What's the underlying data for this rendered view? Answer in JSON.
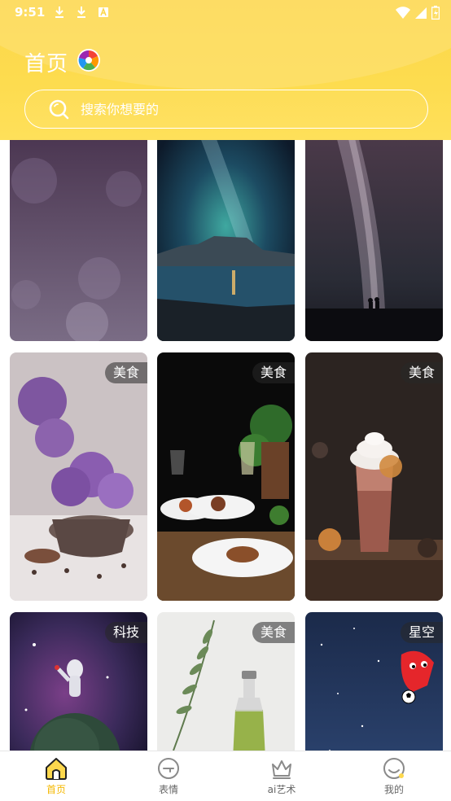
{
  "status_bar": {
    "time": "9:51",
    "icons": [
      "download-icon",
      "download-icon",
      "font-a-icon",
      "wifi-icon",
      "signal-icon",
      "battery-icon"
    ]
  },
  "header": {
    "title": "首页",
    "accent_color": "#fdd84d"
  },
  "search": {
    "placeholder": "搜索你想要的"
  },
  "cards": [
    {
      "tag": "",
      "scene": "purple-bokeh"
    },
    {
      "tag": "",
      "scene": "milky-way-lake"
    },
    {
      "tag": "",
      "scene": "milky-way-couple"
    },
    {
      "tag": "美食",
      "scene": "lavender-cup"
    },
    {
      "tag": "美食",
      "scene": "dinner-plates"
    },
    {
      "tag": "美食",
      "scene": "chocolate-drink"
    },
    {
      "tag": "科技",
      "scene": "astronaut-planet"
    },
    {
      "tag": "美食",
      "scene": "plant-bottle"
    },
    {
      "tag": "星空",
      "scene": "night-sky-mascot"
    }
  ],
  "bottom_nav": {
    "items": [
      {
        "label": "首页",
        "icon": "home-icon",
        "active": true
      },
      {
        "label": "表情",
        "icon": "emoji-icon",
        "active": false
      },
      {
        "label": "ai艺术",
        "icon": "crown-icon",
        "active": false
      },
      {
        "label": "我的",
        "icon": "profile-icon",
        "active": false
      }
    ],
    "active_color": "#f5b800"
  }
}
